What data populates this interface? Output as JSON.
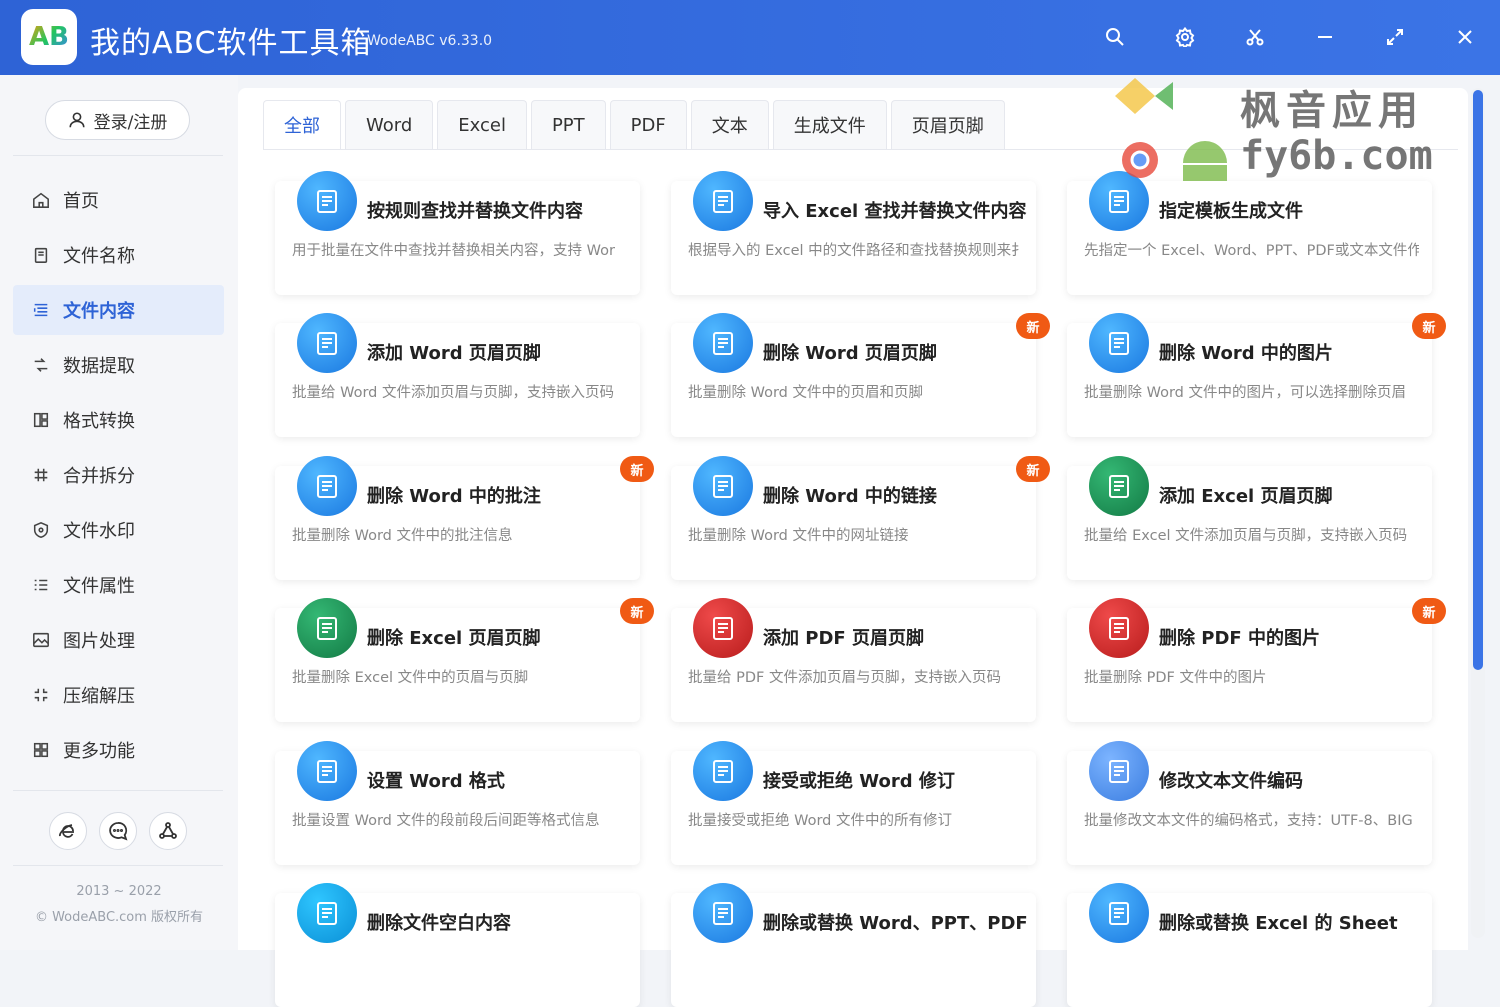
{
  "app": {
    "title": "我的ABC软件工具箱",
    "version": "WodeABC v6.33.0",
    "logo_text": "AB"
  },
  "sidebar": {
    "login_label": "登录/注册",
    "items": [
      {
        "label": "首页",
        "icon": "home-icon"
      },
      {
        "label": "文件名称",
        "icon": "file-name-icon"
      },
      {
        "label": "文件内容",
        "icon": "content-icon",
        "active": true
      },
      {
        "label": "数据提取",
        "icon": "extract-icon"
      },
      {
        "label": "格式转换",
        "icon": "convert-icon"
      },
      {
        "label": "合并拆分",
        "icon": "merge-icon"
      },
      {
        "label": "文件水印",
        "icon": "watermark-icon"
      },
      {
        "label": "文件属性",
        "icon": "properties-icon"
      },
      {
        "label": "图片处理",
        "icon": "image-icon"
      },
      {
        "label": "压缩解压",
        "icon": "compress-icon"
      },
      {
        "label": "更多功能",
        "icon": "more-icon"
      }
    ],
    "copyright_years": "2013 ~ 2022",
    "copyright_text": "© WodeABC.com 版权所有"
  },
  "tabs": [
    "全部",
    "Word",
    "Excel",
    "PPT",
    "PDF",
    "文本",
    "生成文件",
    "页眉页脚"
  ],
  "watermark": {
    "line1": "枫音应用",
    "line2": "fy6b.com"
  },
  "cards": [
    {
      "title": "按规则查找并替换文件内容",
      "desc": "用于批量在文件中查找并替换相关内容，支持 Wor",
      "color": "blue",
      "new": false
    },
    {
      "title": "导入 Excel 查找并替换文件内容",
      "desc": "根据导入的 Excel 中的文件路径和查找替换规则来扌",
      "color": "blue",
      "new": false
    },
    {
      "title": "指定模板生成文件",
      "desc": "先指定一个 Excel、Word、PPT、PDF或文本文件作",
      "color": "blue",
      "new": false
    },
    {
      "title": "添加 Word 页眉页脚",
      "desc": "批量给 Word 文件添加页眉与页脚，支持嵌入页码",
      "color": "blue",
      "new": false
    },
    {
      "title": "删除 Word 页眉页脚",
      "desc": "批量删除 Word 文件中的页眉和页脚",
      "color": "blue",
      "new": true
    },
    {
      "title": "删除 Word 中的图片",
      "desc": "批量删除 Word 文件中的图片，可以选择删除页眉",
      "color": "blue",
      "new": true
    },
    {
      "title": "删除 Word 中的批注",
      "desc": "批量删除 Word 文件中的批注信息",
      "color": "blue",
      "new": true
    },
    {
      "title": "删除 Word 中的链接",
      "desc": "批量删除 Word 文件中的网址链接",
      "color": "blue",
      "new": true
    },
    {
      "title": "添加 Excel 页眉页脚",
      "desc": "批量给 Excel 文件添加页眉与页脚，支持嵌入页码",
      "color": "green",
      "new": false
    },
    {
      "title": "删除 Excel 页眉页脚",
      "desc": "批量删除 Excel 文件中的页眉与页脚",
      "color": "green",
      "new": true
    },
    {
      "title": "添加 PDF 页眉页脚",
      "desc": "批量给 PDF 文件添加页眉与页脚，支持嵌入页码",
      "color": "red",
      "new": false
    },
    {
      "title": "删除 PDF 中的图片",
      "desc": "批量删除 PDF 文件中的图片",
      "color": "red",
      "new": true
    },
    {
      "title": "设置 Word 格式",
      "desc": "批量设置 Word 文件的段前段后间距等格式信息",
      "color": "blue",
      "new": false
    },
    {
      "title": "接受或拒绝 Word 修订",
      "desc": "批量接受或拒绝 Word 文件中的所有修订",
      "color": "blue",
      "new": false
    },
    {
      "title": "修改文本文件编码",
      "desc": "批量修改文本文件的编码格式，支持：UTF-8、BIG",
      "color": "light",
      "new": false
    },
    {
      "title": "删除文件空白内容",
      "desc": "",
      "color": "cyan",
      "new": false
    },
    {
      "title": "删除或替换 Word、PPT、PDF",
      "desc": "",
      "color": "blue",
      "new": false
    },
    {
      "title": "删除或替换 Excel 的 Sheet",
      "desc": "",
      "color": "blue",
      "new": false
    }
  ],
  "badge_label": "新"
}
